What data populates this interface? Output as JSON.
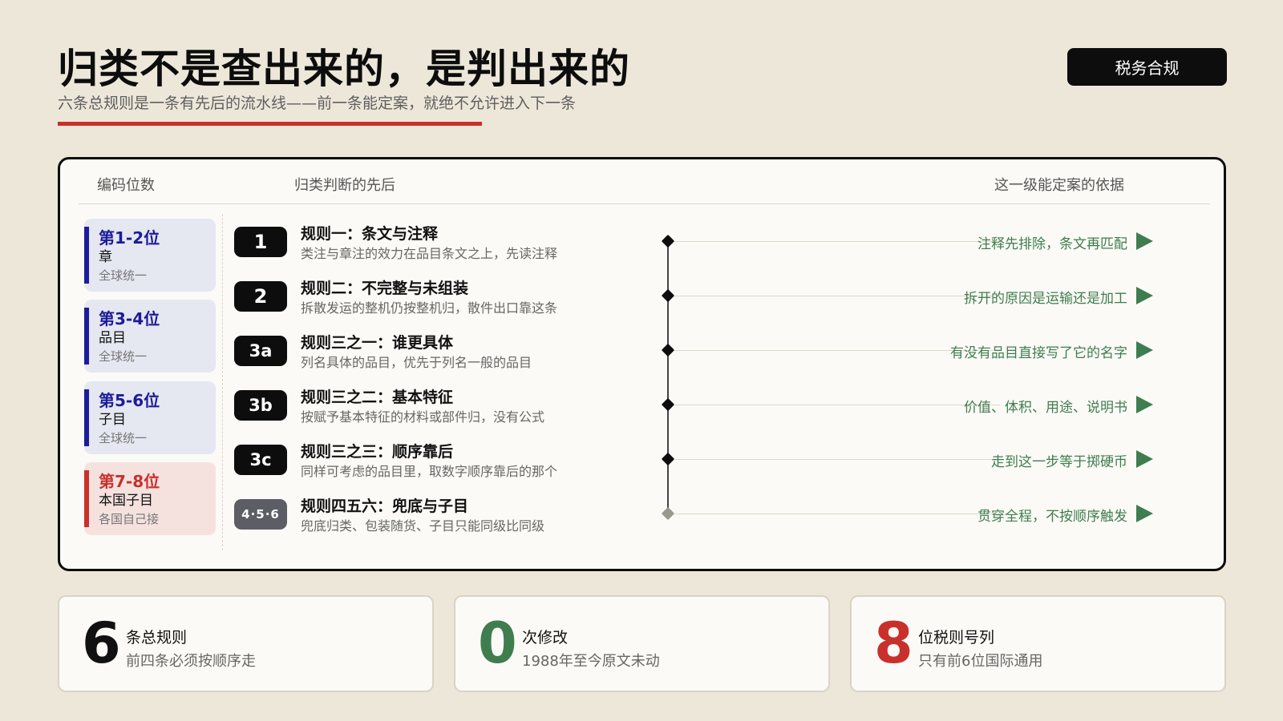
{
  "header": {
    "title": "归类不是查出来的，是判出来的",
    "subtitle": "六条总规则是一条有先后的流水线——前一条能定案，就绝不允许进入下一条",
    "tag": "税务合规"
  },
  "panel": {
    "col_code": "编码位数",
    "col_order": "归类判断的先后",
    "col_basis": "这一级能定案的依据",
    "codes": [
      {
        "digits": "第1-2位",
        "level": "章",
        "note": "全球统一"
      },
      {
        "digits": "第3-4位",
        "level": "品目",
        "note": "全球统一"
      },
      {
        "digits": "第5-6位",
        "level": "子目",
        "note": "全球统一"
      },
      {
        "digits": "第7-8位",
        "level": "本国子目",
        "note": "各国自己接"
      }
    ],
    "rules": [
      {
        "badge": "1",
        "title": "规则一：条文与注释",
        "desc": "类注与章注的效力在品目条文之上，先读注释",
        "basis": "注释先排除，条文再匹配"
      },
      {
        "badge": "2",
        "title": "规则二：不完整与未组装",
        "desc": "拆散发运的整机仍按整机归，散件出口靠这条",
        "basis": "拆开的原因是运输还是加工"
      },
      {
        "badge": "3a",
        "title": "规则三之一：谁更具体",
        "desc": "列名具体的品目，优先于列名一般的品目",
        "basis": "有没有品目直接写了它的名字"
      },
      {
        "badge": "3b",
        "title": "规则三之二：基本特征",
        "desc": "按赋予基本特征的材料或部件归，没有公式",
        "basis": "价值、体积、用途、说明书"
      },
      {
        "badge": "3c",
        "title": "规则三之三：顺序靠后",
        "desc": "同样可考虑的品目里，取数字顺序靠后的那个",
        "basis": "走到这一步等于掷硬币"
      },
      {
        "badge": "4·5·6",
        "title": "规则四五六：兜底与子目",
        "desc": "兜底归类、包装随货、子目只能同级比同级",
        "basis": "贯穿全程，不按顺序触发"
      }
    ]
  },
  "stats": [
    {
      "num": "6",
      "label": "条总规则",
      "note": "前四条必须按顺序走",
      "color": "#111111"
    },
    {
      "num": "0",
      "label": "次修改",
      "note": "1988年至今原文未动",
      "color": "#3f7d4f"
    },
    {
      "num": "8",
      "label": "位税则号列",
      "note": "只有前6位国际通用",
      "color": "#c9302c"
    }
  ]
}
